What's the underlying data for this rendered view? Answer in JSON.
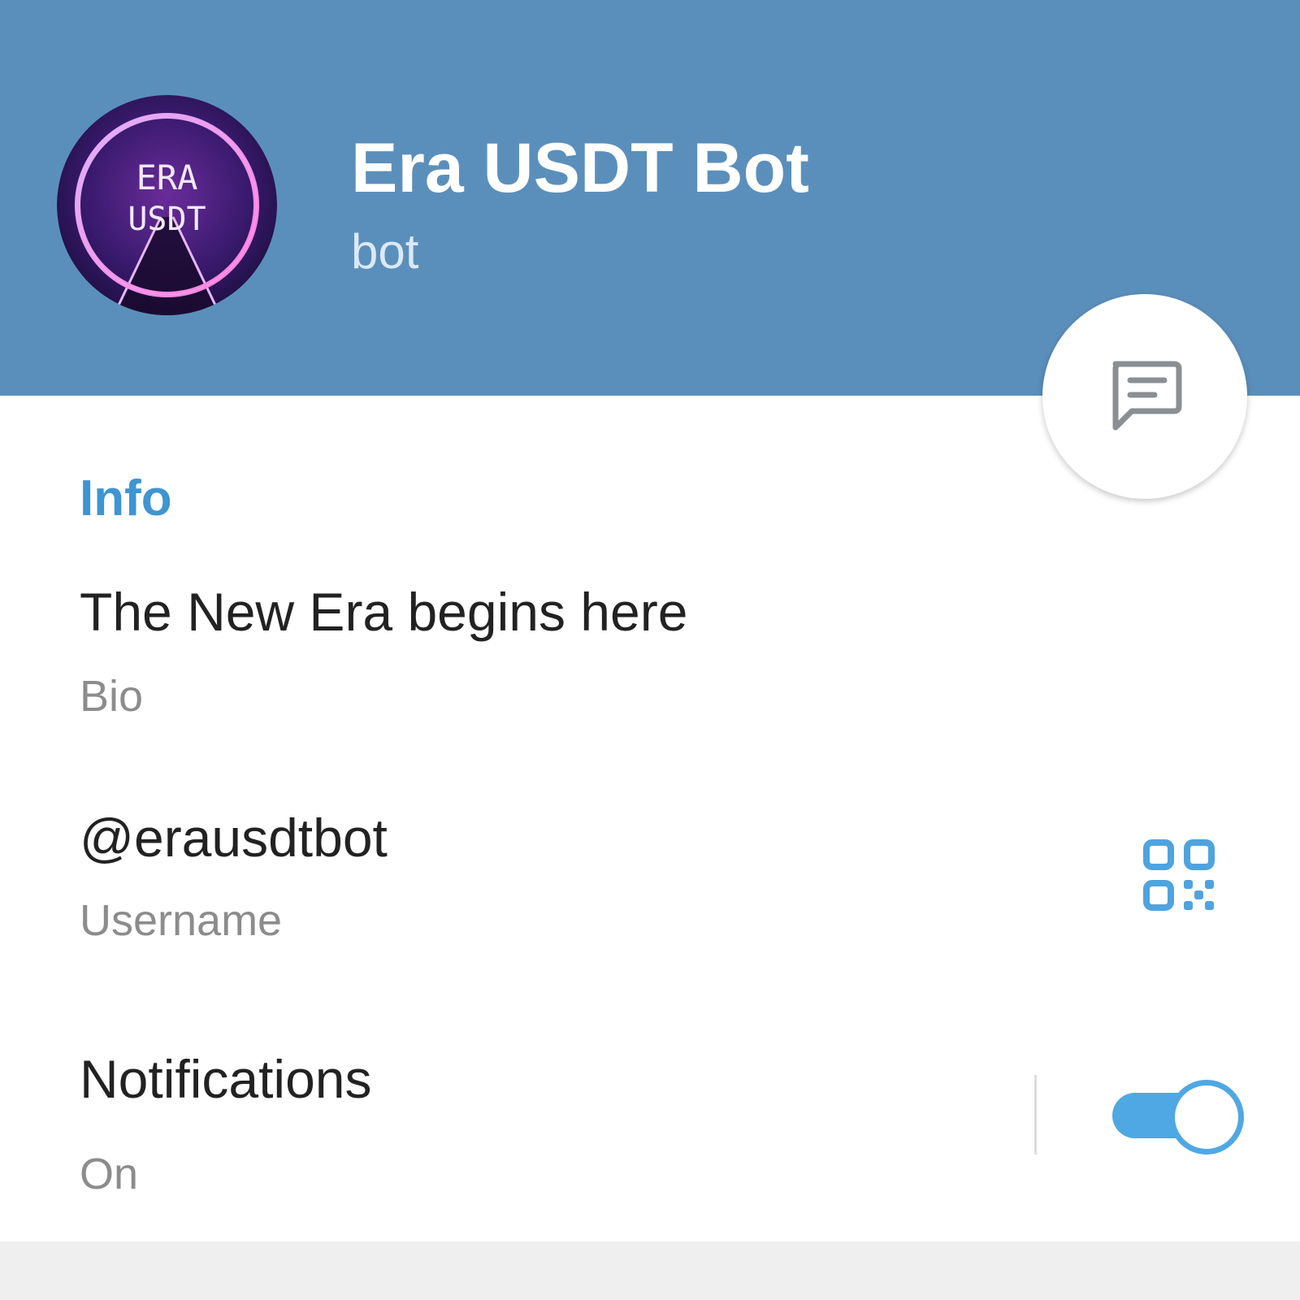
{
  "profile": {
    "name": "Era USDT Bot",
    "type": "bot",
    "avatar_text_line1": "ERA",
    "avatar_text_line2": "USDT"
  },
  "actions": {
    "message_icon": "message-icon"
  },
  "info": {
    "section_title": "Info",
    "bio_value": "The New Era begins here",
    "bio_label": "Bio",
    "username_value": "@erausdtbot",
    "username_label": "Username",
    "qr_icon": "qr-code-icon",
    "notifications_value": "Notifications",
    "notifications_label": "On",
    "notifications_enabled": true
  },
  "colors": {
    "header": "#5b8fbb",
    "accent": "#3e95d1",
    "toggle": "#4fa8e3"
  }
}
